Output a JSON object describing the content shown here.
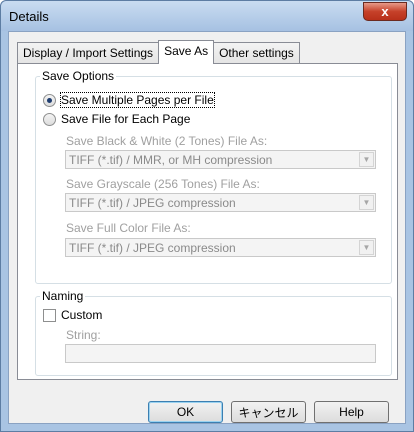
{
  "window": {
    "title": "Details",
    "close_glyph": "x"
  },
  "tabs": [
    {
      "label": "Display / Import Settings",
      "active": false
    },
    {
      "label": "Save As",
      "active": true
    },
    {
      "label": "Other settings",
      "active": false
    }
  ],
  "save_options": {
    "legend": "Save Options",
    "radio_multiple_label": "Save Multiple Pages per File",
    "radio_each_label": "Save File for Each Page",
    "selected": "multiple",
    "bw_label": "Save Black & White (2 Tones) File As:",
    "bw_value": "TIFF (*.tif) / MMR, or MH compression",
    "gray_label": "Save Grayscale (256 Tones) File As:",
    "gray_value": "TIFF (*.tif) / JPEG compression",
    "color_label": "Save Full Color File As:",
    "color_value": "TIFF (*.tif) / JPEG compression"
  },
  "naming": {
    "legend": "Naming",
    "custom_label": "Custom",
    "custom_checked": false,
    "string_label": "String:",
    "string_value": ""
  },
  "buttons": {
    "ok": "OK",
    "cancel": "キャンセル",
    "help": "Help"
  },
  "colors": {
    "titlebar": "#a6c1e2",
    "close": "#c6412a",
    "disabled_text": "#a0a0a0"
  }
}
